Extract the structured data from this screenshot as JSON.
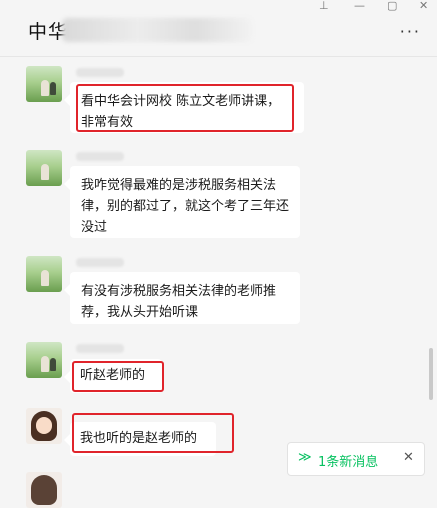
{
  "window": {
    "title": "中华",
    "controls": {
      "pin": "⊥",
      "minimize": "—",
      "maximize": "▢",
      "close": "✕"
    },
    "more_label": "···"
  },
  "messages": [
    {
      "text": "看中华会计网校 陈立文老师讲课，非常有效",
      "highlighted": true,
      "avatar": "tree-couple-avatar"
    },
    {
      "text": "我咋觉得最难的是涉税服务相关法律，别的都过了，就这个考了三年还没过",
      "highlighted": false,
      "avatar": "tree-avatar"
    },
    {
      "text": "有没有涉税服务相关法律的老师推荐，我从头开始听课",
      "highlighted": false,
      "avatar": "tree-avatar"
    },
    {
      "text": "听赵老师的",
      "highlighted": true,
      "avatar": "tree-couple-avatar"
    },
    {
      "text": "我也听的是赵老师的",
      "highlighted": true,
      "avatar": "girl-cartoon-avatar"
    }
  ],
  "new_message_bar": {
    "chevron": "≫",
    "label": "1条新消息",
    "close": "✕"
  },
  "colors": {
    "highlight": "#e0242b",
    "accent": "#07c160",
    "background": "#f5f5f5",
    "bubble": "#ffffff"
  }
}
